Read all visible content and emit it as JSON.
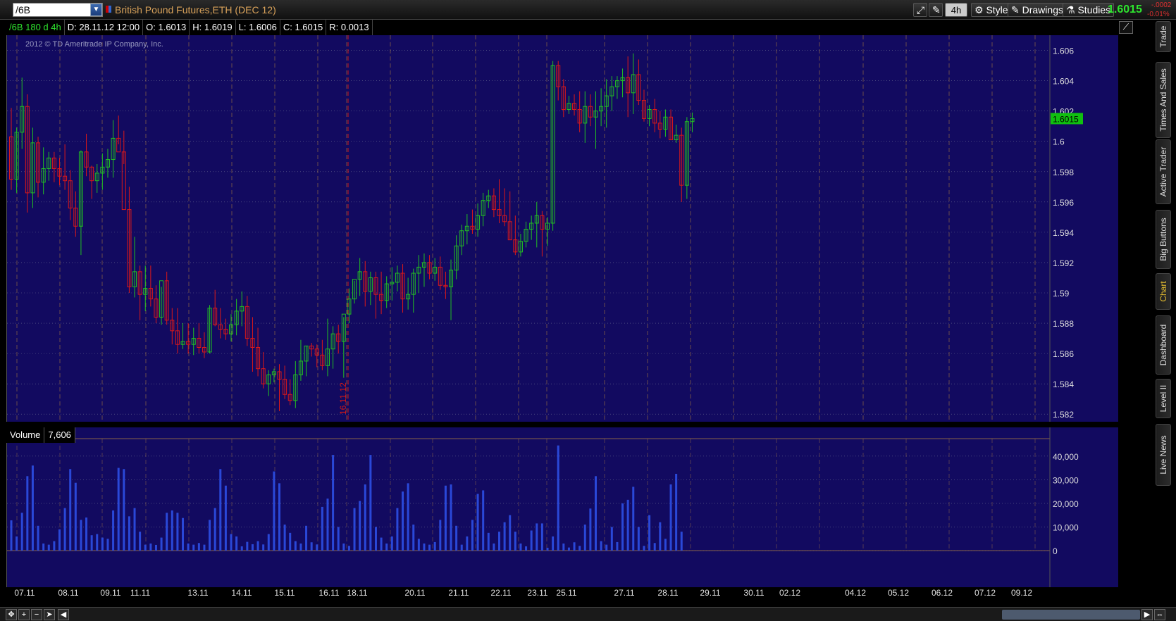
{
  "toolbar": {
    "symbol": "/6B",
    "instrument_name": "British Pound Futures,ETH (DEC 12)",
    "aggregation": "4h",
    "style_label": "Style",
    "drawings_label": "Drawings",
    "studies_label": "Studies",
    "last_price": "1.6015",
    "change_abs": "-.0002",
    "change_pct": "-0.01%"
  },
  "info_bar": {
    "study": "/6B 180 d 4h",
    "date": "D: 28.11.12 12:00",
    "open": "O: 1.6013",
    "high": "H: 1.6019",
    "low": "L: 1.6006",
    "close": "C: 1.6015",
    "range": "R: 0.0013"
  },
  "copyright": "2012 © TD Ameritrade IP Company, Inc.",
  "price_label": "1.6015",
  "marker_label": "16.11.12",
  "volume_header": {
    "label": "Volume",
    "value": "7,606"
  },
  "right_tabs": [
    "Trade",
    "Times And Sales",
    "Active Trader",
    "Big Buttons",
    "Chart",
    "Dashboard",
    "Level II",
    "Live News"
  ],
  "active_tab": "Chart",
  "colors": {
    "background": "#120a60",
    "up": "#22c022",
    "down": "#dd1818",
    "volume": "#2a48d8",
    "grid": "#6a6a90",
    "session": "#b08040"
  },
  "chart_data": [
    {
      "type": "candlestick",
      "title": "/6B 180 d 4h",
      "ylim": [
        1.5815,
        1.607
      ],
      "y_ticks": [
        "1.606",
        "1.604",
        "1.602",
        "1.6",
        "1.598",
        "1.596",
        "1.594",
        "1.592",
        "1.59",
        "1.588",
        "1.586",
        "1.584",
        "1.582"
      ],
      "date_labels": [
        "07.11",
        "08.11",
        "09.11",
        "11.11",
        "13.11",
        "14.11",
        "15.11",
        "16.11",
        "18.11",
        "20.11",
        "21.11",
        "22.11",
        "23.11",
        "25.11",
        "27.11",
        "28.11",
        "29.11",
        "30.11",
        "02.12",
        "04.12",
        "05.12",
        "06.12",
        "07.12",
        "09.12"
      ],
      "candles": [
        [
          1.6003,
          1.6022,
          1.5968,
          1.5975
        ],
        [
          1.5975,
          1.6009,
          1.5966,
          1.6006
        ],
        [
          1.6006,
          1.6042,
          1.5995,
          1.6023
        ],
        [
          1.6023,
          1.6031,
          1.5953,
          1.5966
        ],
        [
          1.5966,
          1.6009,
          1.5956,
          1.5999
        ],
        [
          1.5999,
          1.6003,
          1.5963,
          1.5973
        ],
        [
          1.5973,
          1.5996,
          1.5965,
          1.5982
        ],
        [
          1.5982,
          1.5993,
          1.5974,
          1.5989
        ],
        [
          1.5989,
          1.5993,
          1.5973,
          1.5982
        ],
        [
          1.5982,
          1.5989,
          1.5971,
          1.5977
        ],
        [
          1.5977,
          1.5998,
          1.5968,
          1.5974
        ],
        [
          1.5974,
          1.5981,
          1.5948,
          1.5956
        ],
        [
          1.5956,
          1.5967,
          1.5937,
          1.5944
        ],
        [
          1.5944,
          1.5994,
          1.5925,
          1.5993
        ],
        [
          1.5993,
          1.6005,
          1.5977,
          1.5983
        ],
        [
          1.5983,
          1.5984,
          1.5962,
          1.5974
        ],
        [
          1.5974,
          1.5985,
          1.5966,
          1.5979
        ],
        [
          1.5979,
          1.5992,
          1.5968,
          1.5983
        ],
        [
          1.5983,
          1.5995,
          1.5976,
          1.5988
        ],
        [
          1.5988,
          1.6014,
          1.5976,
          1.6002
        ],
        [
          1.6002,
          1.6017,
          1.5998,
          1.5993
        ],
        [
          1.5993,
          1.6007,
          1.5985,
          1.5955
        ],
        [
          1.5955,
          1.597,
          1.59,
          1.5904
        ],
        [
          1.5904,
          1.5937,
          1.5897,
          1.5914
        ],
        [
          1.5914,
          1.5918,
          1.5882,
          1.5899
        ],
        [
          1.5899,
          1.5918,
          1.5888,
          1.5903
        ],
        [
          1.5903,
          1.5918,
          1.5891,
          1.5896
        ],
        [
          1.5896,
          1.5905,
          1.588,
          1.5884
        ],
        [
          1.5884,
          1.5904,
          1.5879,
          1.5908
        ],
        [
          1.5908,
          1.5914,
          1.5879,
          1.5882
        ],
        [
          1.5882,
          1.589,
          1.5866,
          1.5875
        ],
        [
          1.5875,
          1.589,
          1.586,
          1.5866
        ],
        [
          1.5866,
          1.588,
          1.5863,
          1.5868
        ],
        [
          1.5868,
          1.588,
          1.586,
          1.5866
        ],
        [
          1.5866,
          1.5877,
          1.5859,
          1.587
        ],
        [
          1.587,
          1.588,
          1.586,
          1.5864
        ],
        [
          1.5864,
          1.5874,
          1.5857,
          1.5861
        ],
        [
          1.5861,
          1.5892,
          1.586,
          1.589
        ],
        [
          1.589,
          1.5902,
          1.5878,
          1.5879
        ],
        [
          1.5879,
          1.589,
          1.587,
          1.5876
        ],
        [
          1.5876,
          1.5883,
          1.5869,
          1.5873
        ],
        [
          1.5873,
          1.5886,
          1.5868,
          1.5879
        ],
        [
          1.5879,
          1.5896,
          1.5872,
          1.5888
        ],
        [
          1.5888,
          1.5901,
          1.5878,
          1.5891
        ],
        [
          1.5891,
          1.5898,
          1.5865,
          1.587
        ],
        [
          1.587,
          1.5884,
          1.5848,
          1.5864
        ],
        [
          1.5864,
          1.5877,
          1.5845,
          1.585
        ],
        [
          1.585,
          1.5861,
          1.5837,
          1.584
        ],
        [
          1.584,
          1.5849,
          1.5832,
          1.5846
        ],
        [
          1.5846,
          1.585,
          1.5841,
          1.5848
        ],
        [
          1.5848,
          1.5853,
          1.5822,
          1.5843
        ],
        [
          1.5843,
          1.5852,
          1.583,
          1.5833
        ],
        [
          1.5833,
          1.5843,
          1.5826,
          1.5829
        ],
        [
          1.5829,
          1.5855,
          1.5824,
          1.5846
        ],
        [
          1.5846,
          1.5869,
          1.5842,
          1.5855
        ],
        [
          1.5855,
          1.5865,
          1.5845,
          1.5865
        ],
        [
          1.5865,
          1.5867,
          1.5858,
          1.5863
        ],
        [
          1.5863,
          1.5866,
          1.5851,
          1.5859
        ],
        [
          1.5859,
          1.5869,
          1.5849,
          1.5852
        ],
        [
          1.5852,
          1.5883,
          1.5845,
          1.5863
        ],
        [
          1.5863,
          1.5878,
          1.585,
          1.5873
        ],
        [
          1.5873,
          1.5879,
          1.586,
          1.5868
        ],
        [
          1.5868,
          1.5884,
          1.5844,
          1.5886
        ],
        [
          1.5886,
          1.5903,
          1.588,
          1.5896
        ],
        [
          1.5896,
          1.5908,
          1.5893,
          1.5909
        ],
        [
          1.5909,
          1.5923,
          1.5898,
          1.5914
        ],
        [
          1.5914,
          1.5921,
          1.5891,
          1.5901
        ],
        [
          1.5901,
          1.5914,
          1.5892,
          1.591
        ],
        [
          1.591,
          1.5914,
          1.5883,
          1.5899
        ],
        [
          1.5899,
          1.5914,
          1.5886,
          1.5895
        ],
        [
          1.5895,
          1.5911,
          1.589,
          1.5906
        ],
        [
          1.5906,
          1.5917,
          1.5895,
          1.5907
        ],
        [
          1.5907,
          1.5918,
          1.5901,
          1.5913
        ],
        [
          1.5913,
          1.5919,
          1.5887,
          1.5896
        ],
        [
          1.5896,
          1.591,
          1.5889,
          1.5899
        ],
        [
          1.5899,
          1.5916,
          1.5887,
          1.5913
        ],
        [
          1.5913,
          1.5925,
          1.59,
          1.5917
        ],
        [
          1.5917,
          1.5926,
          1.5904,
          1.592
        ],
        [
          1.592,
          1.5925,
          1.5909,
          1.5913
        ],
        [
          1.5913,
          1.5923,
          1.5908,
          1.5917
        ],
        [
          1.5917,
          1.5924,
          1.5902,
          1.5905
        ],
        [
          1.5905,
          1.5914,
          1.5896,
          1.5904
        ],
        [
          1.5904,
          1.5922,
          1.5882,
          1.5915
        ],
        [
          1.5915,
          1.5938,
          1.5909,
          1.5931
        ],
        [
          1.5931,
          1.5945,
          1.5925,
          1.5941
        ],
        [
          1.5941,
          1.5952,
          1.5932,
          1.5944
        ],
        [
          1.5944,
          1.5955,
          1.5939,
          1.5942
        ],
        [
          1.5942,
          1.5959,
          1.5937,
          1.5951
        ],
        [
          1.5951,
          1.5966,
          1.5944,
          1.5961
        ],
        [
          1.5961,
          1.5968,
          1.5956,
          1.5964
        ],
        [
          1.5964,
          1.5969,
          1.595,
          1.5955
        ],
        [
          1.5955,
          1.5975,
          1.5946,
          1.5951
        ],
        [
          1.5951,
          1.5969,
          1.5944,
          1.5947
        ],
        [
          1.5947,
          1.5967,
          1.5935,
          1.5935
        ],
        [
          1.5935,
          1.5951,
          1.5925,
          1.5927
        ],
        [
          1.5927,
          1.5939,
          1.5924,
          1.5934
        ],
        [
          1.5934,
          1.5947,
          1.593,
          1.5942
        ],
        [
          1.5942,
          1.5951,
          1.5935,
          1.5946
        ],
        [
          1.5946,
          1.596,
          1.593,
          1.5951
        ],
        [
          1.5951,
          1.5954,
          1.5924,
          1.5942
        ],
        [
          1.5942,
          1.595,
          1.5931,
          1.5946
        ],
        [
          1.5946,
          1.6053,
          1.5941,
          1.605
        ],
        [
          1.605,
          1.6053,
          1.6027,
          1.6036
        ],
        [
          1.6036,
          1.6041,
          1.6016,
          1.6021
        ],
        [
          1.6021,
          1.603,
          1.6018,
          1.6025
        ],
        [
          1.6025,
          1.6031,
          1.6017,
          1.6021
        ],
        [
          1.6021,
          1.6033,
          1.6006,
          1.6012
        ],
        [
          1.6012,
          1.6033,
          1.5999,
          1.6023
        ],
        [
          1.6023,
          1.6031,
          1.601,
          1.6016
        ],
        [
          1.6016,
          1.6033,
          1.5995,
          1.602
        ],
        [
          1.602,
          1.6035,
          1.601,
          1.6023
        ],
        [
          1.6023,
          1.6041,
          1.6009,
          1.603
        ],
        [
          1.603,
          1.6043,
          1.602,
          1.6036
        ],
        [
          1.6036,
          1.6043,
          1.6028,
          1.604
        ],
        [
          1.604,
          1.6048,
          1.6029,
          1.6042
        ],
        [
          1.6042,
          1.6056,
          1.6016,
          1.6032
        ],
        [
          1.6032,
          1.6058,
          1.6018,
          1.6044
        ],
        [
          1.6044,
          1.6054,
          1.6024,
          1.6027
        ],
        [
          1.6027,
          1.6034,
          1.6013,
          1.6015
        ],
        [
          1.6015,
          1.6024,
          1.601,
          1.6021
        ],
        [
          1.6021,
          1.6028,
          1.6006,
          1.6012
        ],
        [
          1.6012,
          1.602,
          1.6002,
          1.6008
        ],
        [
          1.6008,
          1.6021,
          1.6003,
          1.6016
        ],
        [
          1.6016,
          1.6021,
          1.6001,
          1.6001
        ],
        [
          1.6001,
          1.6011,
          1.5999,
          1.6004
        ],
        [
          1.6004,
          1.6009,
          1.596,
          1.5971
        ],
        [
          1.5971,
          1.6016,
          1.5962,
          1.6013
        ],
        [
          1.6013,
          1.6019,
          1.6006,
          1.6015
        ]
      ]
    },
    {
      "type": "bar",
      "title": "Volume",
      "ylim": [
        0,
        45000
      ],
      "y_ticks": [
        "40,000",
        "30,000",
        "20,000",
        "10,000",
        "0"
      ],
      "values": [
        12800,
        6000,
        16000,
        31500,
        36000,
        10500,
        3000,
        2500,
        4000,
        9000,
        18000,
        34500,
        28700,
        13000,
        14000,
        6500,
        7000,
        5500,
        5000,
        17000,
        35000,
        34500,
        14500,
        18000,
        8000,
        2500,
        3000,
        2400,
        5500,
        16000,
        17000,
        16000,
        13800,
        3000,
        2500,
        3200,
        2500,
        13000,
        18000,
        34500,
        27500,
        7000,
        6000,
        1800,
        3700,
        2700,
        4000,
        2600,
        7000,
        33500,
        28500,
        11000,
        7500,
        4000,
        3000,
        10500,
        3500,
        2600,
        18500,
        22000,
        40500,
        10000,
        3000,
        2000,
        18000,
        21000,
        28000,
        40500,
        10000,
        5500,
        3000,
        6000,
        18000,
        25000,
        28500,
        11000,
        5000,
        3000,
        2500,
        3600,
        13000,
        27500,
        28000,
        10500,
        2500,
        6000,
        13000,
        24000,
        25500,
        7500,
        3000,
        8000,
        12000,
        15000,
        8000,
        3000,
        1800,
        8500,
        11500,
        11500,
        1200,
        6000,
        44500,
        3000,
        1300,
        3500,
        2000,
        11000,
        17800,
        31500,
        4000,
        2500,
        10000,
        3600,
        20000,
        21500,
        27000,
        10000,
        2000,
        15000,
        3200,
        12000,
        5000,
        28000,
        32500,
        8000
      ],
      "latest": 7606
    }
  ]
}
